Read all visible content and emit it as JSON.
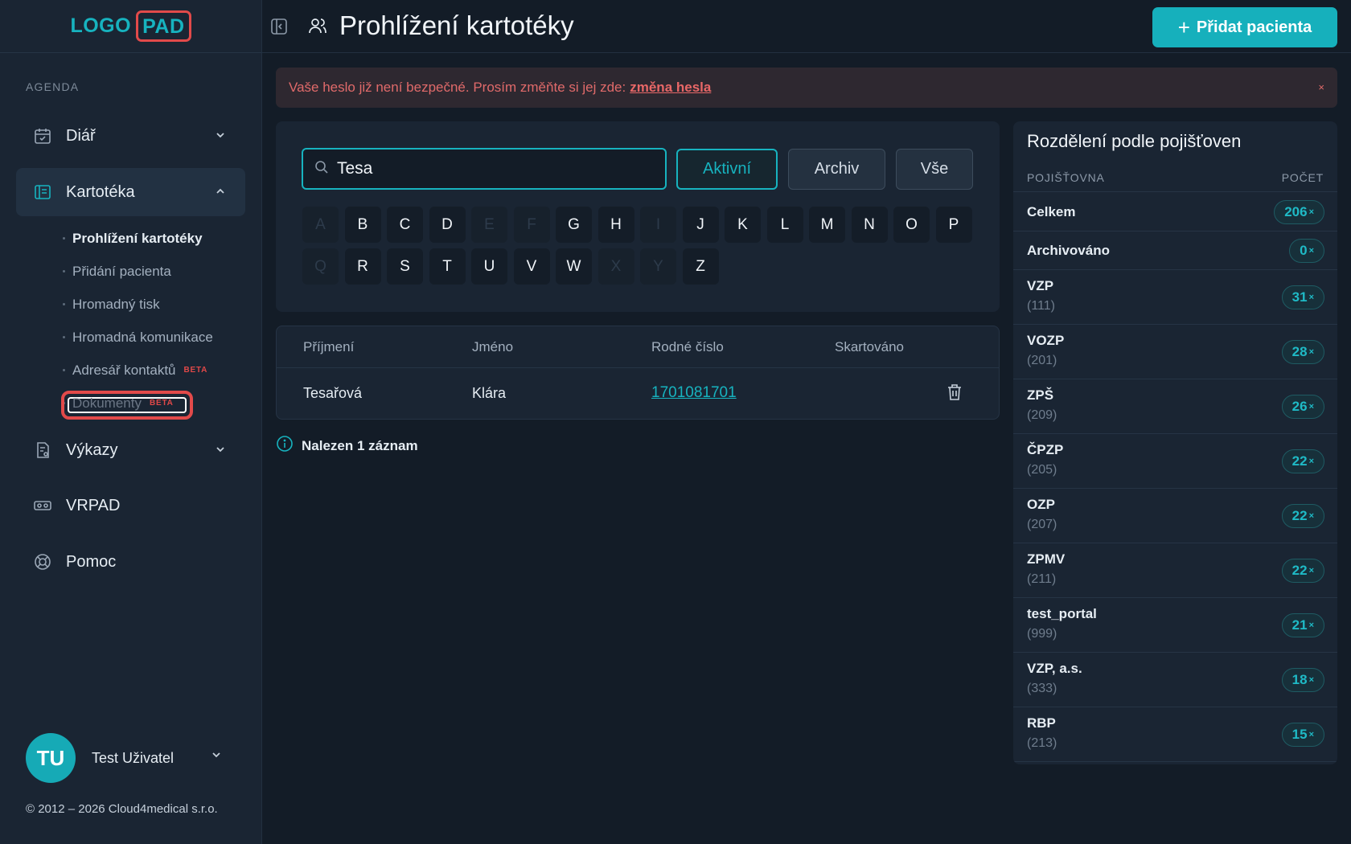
{
  "logo": {
    "part1": "LOGO",
    "part2": "PAD"
  },
  "sidebar": {
    "section_title": "AGENDA",
    "items": [
      {
        "label": "Diář"
      },
      {
        "label": "Kartotéka"
      },
      {
        "label": "Výkazy"
      },
      {
        "label": "VRPAD"
      },
      {
        "label": "Pomoc"
      }
    ],
    "sub_items": [
      {
        "label": "Prohlížení kartotéky"
      },
      {
        "label": "Přidání pacienta"
      },
      {
        "label": "Hromadný tisk"
      },
      {
        "label": "Hromadná komunikace"
      },
      {
        "label": "Adresář kontaktů",
        "badge": "BETA"
      },
      {
        "label": "Dokumenty",
        "badge": "BETA"
      }
    ],
    "user": {
      "initials": "TU",
      "name": "Test Uživatel"
    },
    "copyright": "© 2012 – 2026 Cloud4medical s.r.o."
  },
  "header": {
    "title": "Prohlížení kartotéky",
    "add_button": "Přidat pacienta"
  },
  "alert": {
    "text": "Vaše heslo již není bezpečné. Prosím změňte si jej zde:",
    "link": "změna hesla",
    "close": "×"
  },
  "search": {
    "value": "Tesa",
    "filters": [
      "Aktivní",
      "Archiv",
      "Vše"
    ]
  },
  "letters_row1": [
    "A",
    "B",
    "C",
    "D",
    "E",
    "F",
    "G",
    "H",
    "I",
    "J",
    "K",
    "L",
    "M",
    "N",
    "O",
    "P"
  ],
  "letters_row2": [
    "Q",
    "R",
    "S",
    "T",
    "U",
    "V",
    "W",
    "X",
    "Y",
    "Z"
  ],
  "table": {
    "headers": [
      "Příjmení",
      "Jméno",
      "Rodné číslo",
      "Skartováno"
    ],
    "rows": [
      {
        "surname": "Tesařová",
        "name": "Klára",
        "rc": "1701081701",
        "skart": ""
      }
    ]
  },
  "found_text": "Nalezen 1 záznam",
  "insurance": {
    "title": "Rozdělení podle pojišťoven",
    "col1": "POJIŠŤOVNA",
    "col2": "POČET",
    "rows": [
      {
        "name": "Celkem",
        "code": "",
        "count": "206"
      },
      {
        "name": "Archivováno",
        "code": "",
        "count": "0"
      },
      {
        "name": "VZP",
        "code": "(111)",
        "count": "31"
      },
      {
        "name": "VOZP",
        "code": "(201)",
        "count": "28"
      },
      {
        "name": "ZPŠ",
        "code": "(209)",
        "count": "26"
      },
      {
        "name": "ČPZP",
        "code": "(205)",
        "count": "22"
      },
      {
        "name": "OZP",
        "code": "(207)",
        "count": "22"
      },
      {
        "name": "ZPMV",
        "code": "(211)",
        "count": "22"
      },
      {
        "name": "test_portal",
        "code": "(999)",
        "count": "21"
      },
      {
        "name": "VZP, a.s.",
        "code": "(333)",
        "count": "18"
      },
      {
        "name": "RBP",
        "code": "(213)",
        "count": "15"
      }
    ],
    "count_suffix": "×"
  }
}
